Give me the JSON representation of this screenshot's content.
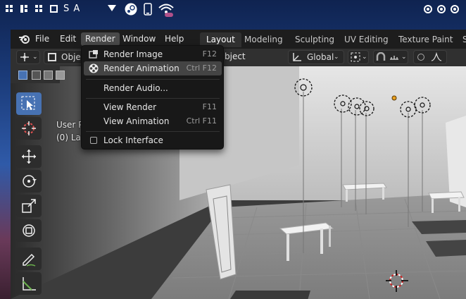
{
  "system_bar": {
    "letters": "S A"
  },
  "menubar": {
    "items": [
      {
        "label": "File"
      },
      {
        "label": "Edit"
      },
      {
        "label": "Render"
      },
      {
        "label": "Window"
      },
      {
        "label": "Help"
      }
    ],
    "workspaces": [
      {
        "label": "Layout"
      },
      {
        "label": "Modeling"
      },
      {
        "label": "Sculpting"
      },
      {
        "label": "UV Editing"
      },
      {
        "label": "Texture Paint"
      },
      {
        "label": "S"
      }
    ]
  },
  "header": {
    "mode_label": "Obje",
    "object_menu": "bject",
    "orientation": "Global"
  },
  "viewport": {
    "overlay_line1": "User P",
    "overlay_line2": "(0) La"
  },
  "render_menu": {
    "items": [
      {
        "label": "Render Image",
        "shortcut": "F12"
      },
      {
        "label": "Render Animation",
        "shortcut": "Ctrl F12"
      },
      {
        "label": "Render Audio...",
        "shortcut": ""
      },
      {
        "label": "View Render",
        "shortcut": "F11"
      },
      {
        "label": "View Animation",
        "shortcut": "Ctrl F11"
      },
      {
        "label": "Lock Interface",
        "shortcut": ""
      }
    ]
  },
  "colors": {
    "accent": "#4772b3",
    "menu_bg": "#181818",
    "highlight": "#444444"
  }
}
